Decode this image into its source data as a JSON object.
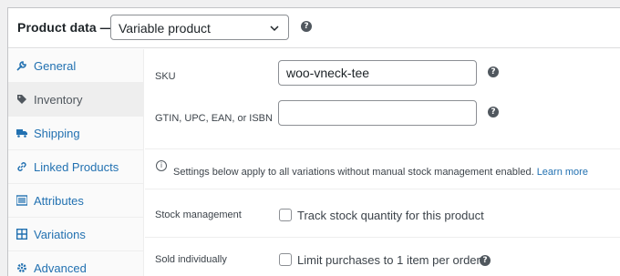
{
  "header": {
    "title": "Product data —",
    "product_type": "Variable product",
    "help_icon": "question-circle-icon"
  },
  "tabs": [
    {
      "label": "General",
      "icon": "wrench-icon",
      "active": false
    },
    {
      "label": "Inventory",
      "icon": "tag-icon",
      "active": true
    },
    {
      "label": "Shipping",
      "icon": "truck-icon",
      "active": false
    },
    {
      "label": "Linked Products",
      "icon": "link-icon",
      "active": false
    },
    {
      "label": "Attributes",
      "icon": "list-icon",
      "active": false
    },
    {
      "label": "Variations",
      "icon": "grid-icon",
      "active": false
    },
    {
      "label": "Advanced",
      "icon": "gear-icon",
      "active": false
    }
  ],
  "inventory": {
    "sku_label": "SKU",
    "sku_value": "woo-vneck-tee",
    "gtin_label": "GTIN, UPC, EAN, or ISBN",
    "gtin_value": "",
    "notice_text": "Settings below apply to all variations without manual stock management enabled.",
    "notice_link": "Learn more",
    "stock_management_label": "Stock management",
    "stock_management_checkbox_label": "Track stock quantity for this product",
    "stock_management_checked": false,
    "sold_individually_label": "Sold individually",
    "sold_individually_checkbox_label": "Limit purchases to 1 item per order",
    "sold_individually_checked": false
  },
  "colors": {
    "link": "#2271b1",
    "text": "#1d2327",
    "border": "#8c8f94",
    "tab_bg": "#fafafa",
    "tab_active_bg": "#eeeeee"
  }
}
